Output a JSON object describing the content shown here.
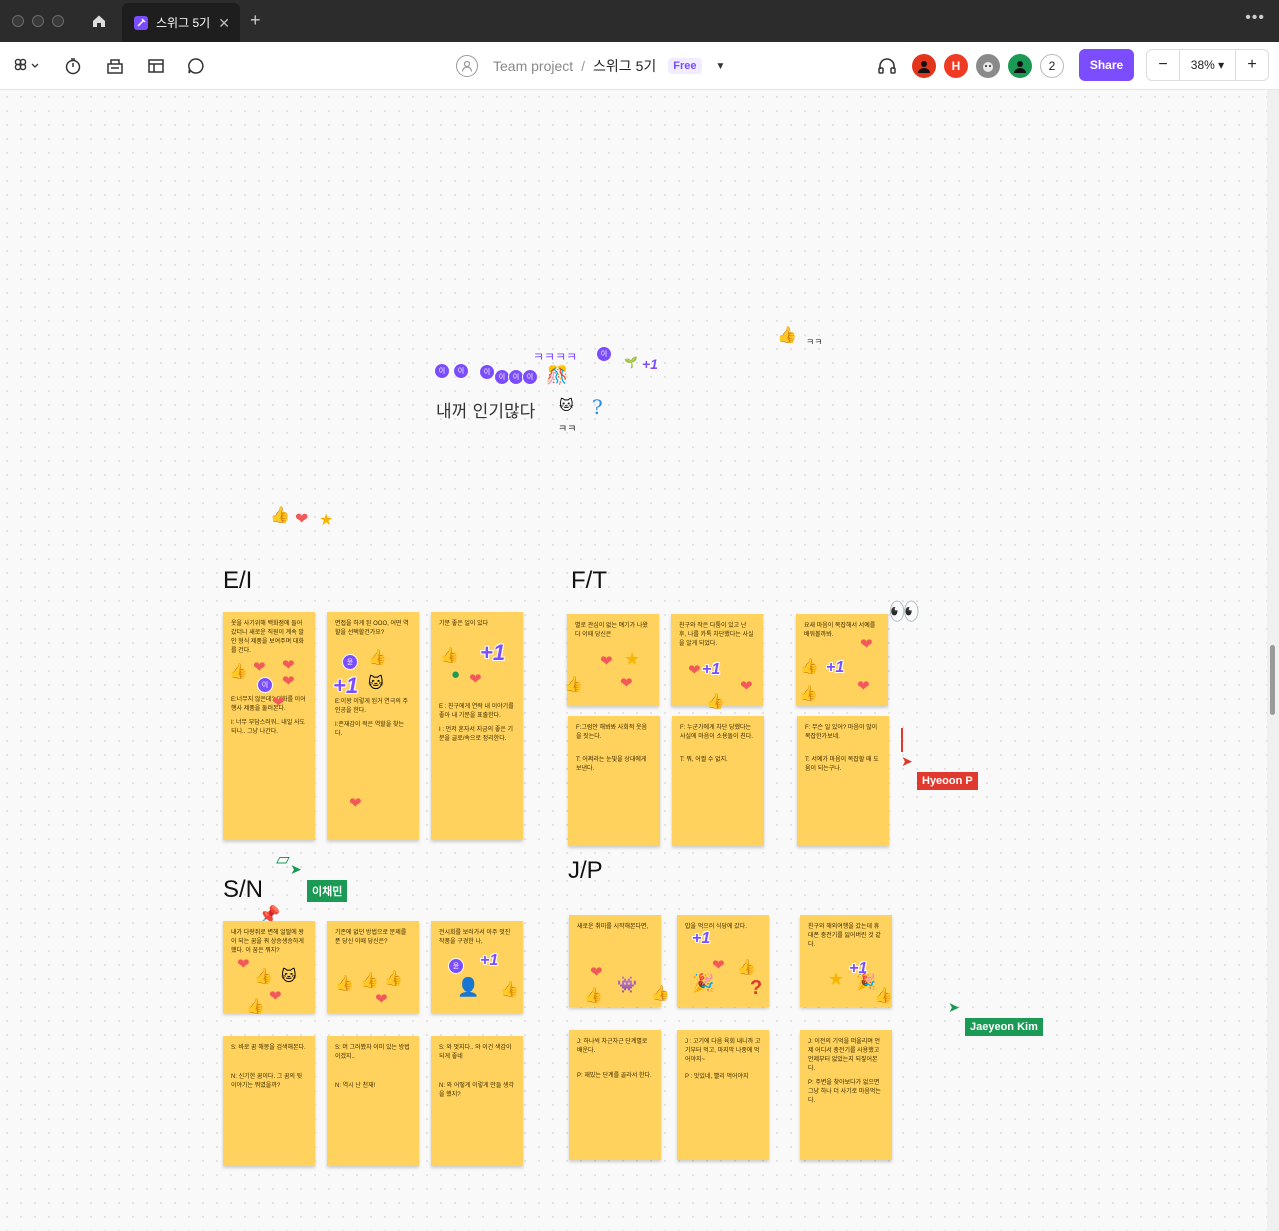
{
  "window": {
    "tab_title": "스위그 5기",
    "new_tab_symbol": "+",
    "close_symbol": "✕",
    "more_symbol": "•••"
  },
  "toolbar": {
    "project": "Team project",
    "separator": "/",
    "file_name": "스위그 5기",
    "plan_badge": "Free",
    "avatar_h_initial": "H",
    "extra_users_count": "2",
    "share_label": "Share",
    "zoom_level": "38%",
    "zoom_out": "−",
    "zoom_in": "+"
  },
  "canvas": {
    "handwriting": {
      "main": "내꺼 인기많다",
      "laugh_top": "ㅋㅋㅋㅋ",
      "laugh_bottom": "ㅋㅋ",
      "question": "?",
      "kk": "ㅋㅋ"
    },
    "sections": {
      "ei": "E/I",
      "ft": "F/T",
      "sn": "S/N",
      "jp": "J/P"
    },
    "notes": {
      "ei_1": [
        "옷을 사기위해 백화점에 들어갔더니 새로운 직원이 계속 말인 형식 제품을 보여주며 대화를 건다.",
        "E:너무지 않은데? 대화를 이어 행사 제품을 둘러본다.",
        "I: 너무 부담스러워.. 내일 사도 되니.. 그냥 나간다."
      ],
      "ei_2": [
        "면접을 하게 된 OOO, 어떤 역할을 선택할건가요?",
        "E:이왕 이렇게 된거 연극의 주인공을 한다.",
        "I:존재감이 적은 역할을 찾는다."
      ],
      "ei_3": [
        "기분 좋은 일이 있다",
        "E : 친구에게 연락 내 이야기를 좋아 내 기분을 표출한다.",
        "I : 먼저 혼자서 지금의 좋은 기분을 글로/속으로 정리한다."
      ],
      "ft_1": [
        "별로 관심이 없는 얘기가 나왔다 이때 당신은"
      ],
      "ft_2": [
        "친구와 작은 다툼이 있고 난 후, 나를 카톡 차단했다는 사실을 알게 되었다."
      ],
      "ft_3": [
        "요새 마음이 복잡해서 서예를 배워볼까봐."
      ],
      "ft_4": [
        "F:그럼안 해봐봐 사회적 웃음을 짓는다.",
        "T: 어쩌라는 눈빛을 상대에게 보낸다."
      ],
      "ft_5": [
        "F: 누군가에게 차단 당했다는 사실에 마음이 소용돌이 친다.",
        "T: 뭐, 어쩔 수 없지."
      ],
      "ft_6": [
        "F: 무슨 일 있어? 마음이 많이 복잡한가보네.",
        "T: 서예가 마음이 복잡할 때 도움이 되는구나."
      ],
      "sn_1": [
        "내가 다랑쥐로 변해 얼떨에 왕이 되는 꿈을 꿔 상승생승하게 했다. 이 꿈은 뭐지?"
      ],
      "sn_2": [
        "기존에 없던 방법으로 문제를 푼 당신 이때 당신은?"
      ],
      "sn_3": [
        "전시회를 보러가서 아주 멋진 작품을 구경한 나,"
      ],
      "sn_4": [
        "S: 바로 꿈 해몽을 검색해본다.",
        "N: 신기한 꿈이다. 그 꿈의 뒷 이야기는 뭐였을까?"
      ],
      "sn_5": [
        "S: 머 그러봤자 이미 있는 방법 이겠지..",
        "N: 역시 난 천재!"
      ],
      "sn_6": [
        "S: 와 멋지다.. 와 이건 색감이 되게 좋네",
        "N: 와 어떻게 이렇게 만들 생각을 했지?"
      ],
      "jp_1": [
        "새로운 취미를 시작해본다면,"
      ],
      "jp_2": [
        "밥을 먹으러 식당에 갔다."
      ],
      "jp_3": [
        "친구와 해외여행을 갔는데 휴대폰 충전기를 잃어버린 것 같다."
      ],
      "jp_4": [
        "J: 하나씩 차근차근 단계별로 배운다.",
        "P: 재밌는 단계를 골라서 한다."
      ],
      "jp_5": [
        "J : 고기에 다음 육회 내니까 고기부터 먹고, 마지막 나중에 먹어야지~",
        "P : 맛있네, 빨리 먹어야지"
      ],
      "jp_6": [
        "J: 이전의 기억을 떠올리며 언제 어디서 충전기를 사용했고 언제부터 없었는지 되짚어본다.",
        "P: 주변을 찾아보다가 없으면 그냥 하나 더 사기로 마음먹는다."
      ]
    },
    "avatar_letters": {
      "i": "이",
      "yoon": "윤",
      "io": "이"
    },
    "plus_one": "+1",
    "cursors": {
      "lee": "이채민",
      "hyeoon": "Hyeoon P",
      "jaeyeon": "Jaeyeon Kim"
    },
    "colors": {
      "sticky": "#ffd25e",
      "accent": "#7b4dff",
      "cursor_green": "#1a9a54",
      "cursor_red": "#e03a2f"
    }
  }
}
